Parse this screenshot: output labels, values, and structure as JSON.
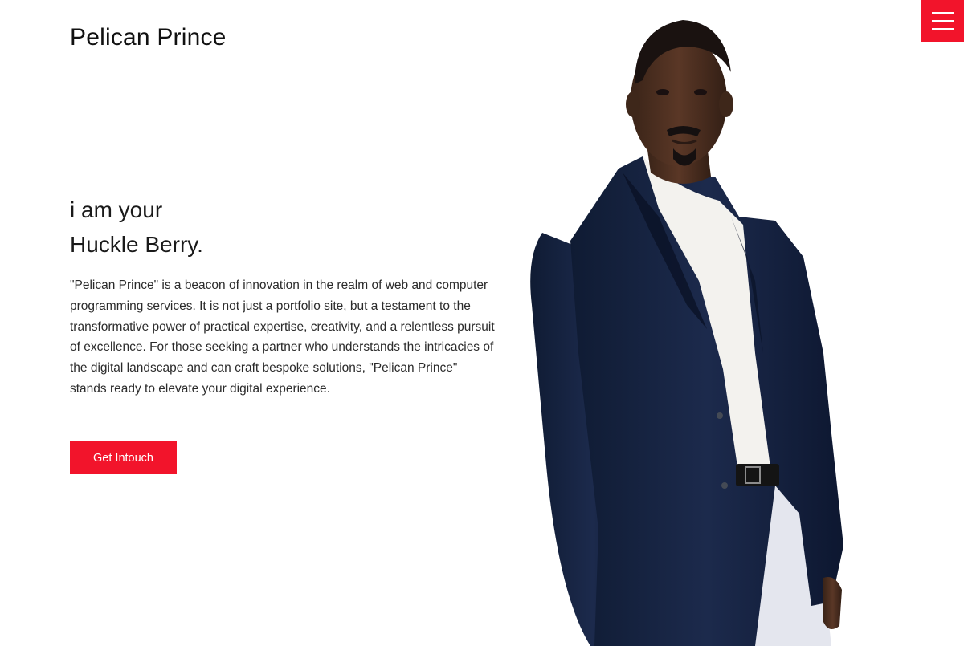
{
  "header": {
    "brand": "Pelican Prince",
    "menu_icon": "hamburger-menu-icon",
    "accent_color": "#f2142b"
  },
  "hero": {
    "heading_line1": "i am your",
    "heading_line2": "Huckle Berry.",
    "description": "\"Pelican Prince\" is a beacon of innovation in the realm of web and computer programming services. It is not just a portfolio site, but a testament to the transformative power of practical expertise, creativity, and a relentless pursuit of excellence. For those seeking a partner who understands the intricacies of the digital landscape and can craft bespoke solutions, \"Pelican Prince\" stands ready to elevate your digital experience.",
    "cta_label": "Get Intouch"
  }
}
